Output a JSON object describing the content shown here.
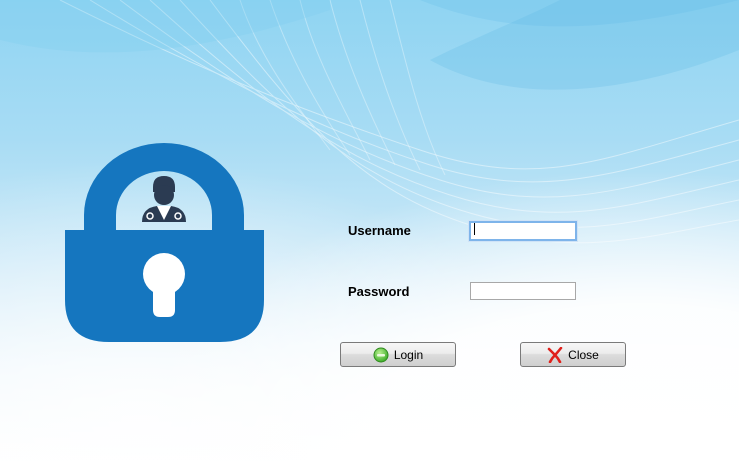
{
  "login_form": {
    "username_label": "Username",
    "username_value": "",
    "password_label": "Password",
    "password_value": "",
    "login_button_label": "Login",
    "close_button_label": "Close"
  },
  "icons": {
    "lock": "padlock-doctor-icon",
    "login": "green-minus-circle-icon",
    "close": "red-x-icon"
  },
  "colors": {
    "lock_blue": "#1576bf",
    "login_icon_green": "#3fae2a",
    "close_icon_red": "#e0201b"
  }
}
